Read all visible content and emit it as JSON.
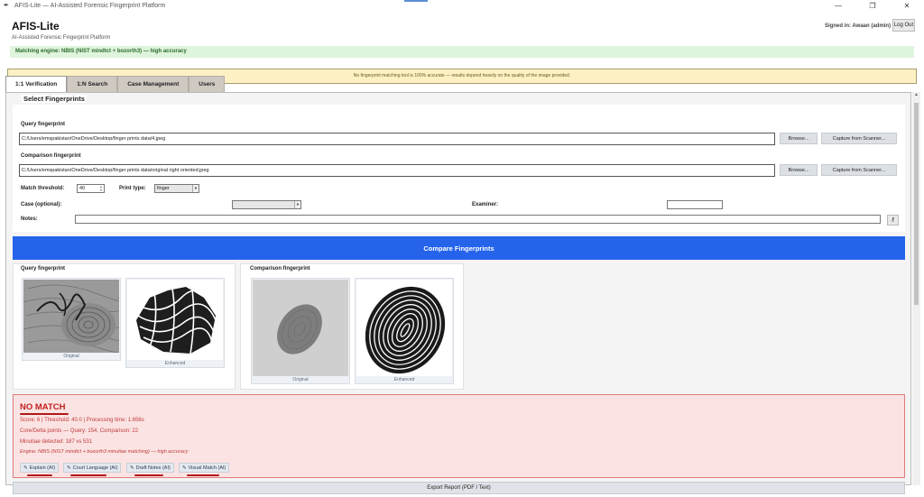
{
  "window": {
    "title": "AFIS-Lite — AI-Assisted Forensic Fingerprint Platform",
    "controls": [
      "—",
      "❐",
      "✕"
    ]
  },
  "header": {
    "app_title": "AFIS-Lite",
    "subtitle": "AI-Assisted Forensic Fingerprint Platform",
    "signed_in": "Signed in: Awaan (admin)",
    "logout_label": "Log Out",
    "engine_status": "Matching engine: NBIS (NIST mindtct + bozorth3) — high accuracy",
    "warning": "No fingerprint matching tool is 100% accurate — results depend heavily on the quality of the image provided."
  },
  "tabs": [
    {
      "label": "1:1 Verification",
      "active": true
    },
    {
      "label": "1:N Search",
      "active": false
    },
    {
      "label": "Case Management",
      "active": false
    },
    {
      "label": "Users",
      "active": false
    }
  ],
  "select": {
    "section_title": "Select Fingerprints",
    "query_label": "Query fingerprint",
    "query_path": "C:/Users/emspakistan/OneDrive/Desktop/finger prints data/4.jpeg",
    "comparison_label": "Comparison fingerprint",
    "comparison_path": "C:/Users/emspakistan/OneDrive/Desktop/finger prints data/original right oriented.jpeg",
    "browse_label": "Browse...",
    "scanner_label": "Capture from Scanner...",
    "threshold_label": "Match threshold:",
    "threshold_value": "40",
    "print_type_label": "Print type:",
    "print_type_value": "finger",
    "case_label": "Case (optional):",
    "case_value": "",
    "examiner_label": "Examiner:",
    "examiner_value": "",
    "notes_label": "Notes:",
    "notes_value": ""
  },
  "compare_label": "Compare Fingerprints",
  "images": {
    "query_title": "Query fingerprint",
    "comparison_title": "Comparison fingerprint",
    "original_caption": "Original",
    "enhanced_caption": "Enhanced"
  },
  "result": {
    "verdict": "NO MATCH",
    "score_line": "Score: 6   |   Threshold: 40.0   |   Processing time: 1.656s",
    "core_line": "Core/Delta points — Query: 154, Comparison: 22",
    "minutiae_line": "Minutiae detected: 187 vs 531",
    "engine_line": "Engine: NBIS (NIST mindtct + bozorth3 minutiae matching) — high accuracy",
    "ai_buttons": [
      "Explain (AI)",
      "Court Language (AI)",
      "Draft Notes (AI)",
      "Visual Match (AI)"
    ],
    "export_label": "Export Report (PDF / Text)"
  },
  "colors": {
    "accent": "#2563eb",
    "no_match": "#c21f1f",
    "engine_ok": "#dff4dc",
    "warning_bg": "#fdf1c4"
  }
}
